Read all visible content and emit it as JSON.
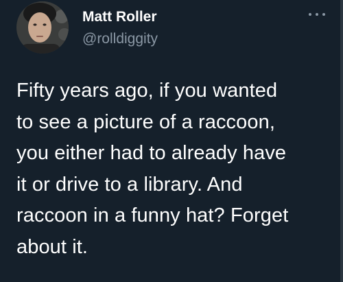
{
  "tweet": {
    "author": {
      "display_name": "Matt Roller",
      "handle": "@rolldiggity",
      "avatar": "profile-photo"
    },
    "more_icon": "more-horizontal-icon",
    "text_lines": [
      "Fifty years ago, if you wanted",
      "to see a picture of a raccoon,",
      "you either had to already have",
      "it or drive to a library. And",
      "raccoon in a funny hat? Forget",
      "about it."
    ]
  },
  "colors": {
    "background": "#15202b",
    "primary_text": "#ffffff",
    "secondary_text": "#8b98a5"
  }
}
